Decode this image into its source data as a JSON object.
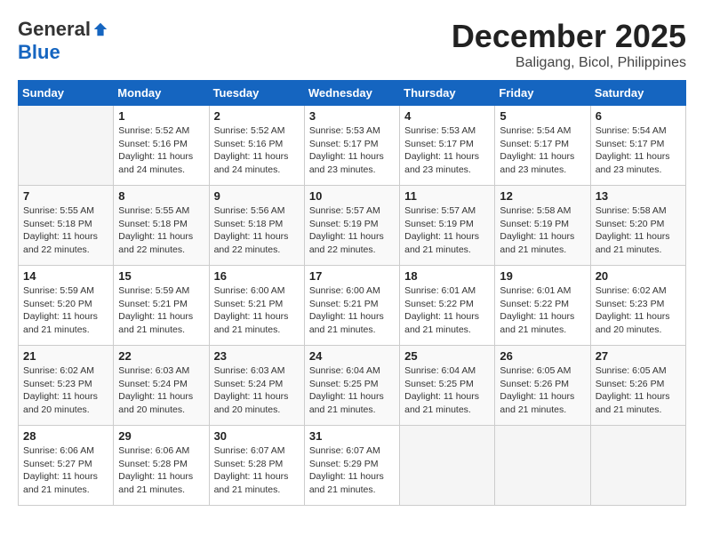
{
  "header": {
    "logo": {
      "general": "General",
      "blue": "Blue"
    },
    "month": "December 2025",
    "location": "Baligang, Bicol, Philippines"
  },
  "weekdays": [
    "Sunday",
    "Monday",
    "Tuesday",
    "Wednesday",
    "Thursday",
    "Friday",
    "Saturday"
  ],
  "weeks": [
    [
      {
        "day": "",
        "info": ""
      },
      {
        "day": "1",
        "info": "Sunrise: 5:52 AM\nSunset: 5:16 PM\nDaylight: 11 hours\nand 24 minutes."
      },
      {
        "day": "2",
        "info": "Sunrise: 5:52 AM\nSunset: 5:16 PM\nDaylight: 11 hours\nand 24 minutes."
      },
      {
        "day": "3",
        "info": "Sunrise: 5:53 AM\nSunset: 5:17 PM\nDaylight: 11 hours\nand 23 minutes."
      },
      {
        "day": "4",
        "info": "Sunrise: 5:53 AM\nSunset: 5:17 PM\nDaylight: 11 hours\nand 23 minutes."
      },
      {
        "day": "5",
        "info": "Sunrise: 5:54 AM\nSunset: 5:17 PM\nDaylight: 11 hours\nand 23 minutes."
      },
      {
        "day": "6",
        "info": "Sunrise: 5:54 AM\nSunset: 5:17 PM\nDaylight: 11 hours\nand 23 minutes."
      }
    ],
    [
      {
        "day": "7",
        "info": "Sunrise: 5:55 AM\nSunset: 5:18 PM\nDaylight: 11 hours\nand 22 minutes."
      },
      {
        "day": "8",
        "info": "Sunrise: 5:55 AM\nSunset: 5:18 PM\nDaylight: 11 hours\nand 22 minutes."
      },
      {
        "day": "9",
        "info": "Sunrise: 5:56 AM\nSunset: 5:18 PM\nDaylight: 11 hours\nand 22 minutes."
      },
      {
        "day": "10",
        "info": "Sunrise: 5:57 AM\nSunset: 5:19 PM\nDaylight: 11 hours\nand 22 minutes."
      },
      {
        "day": "11",
        "info": "Sunrise: 5:57 AM\nSunset: 5:19 PM\nDaylight: 11 hours\nand 21 minutes."
      },
      {
        "day": "12",
        "info": "Sunrise: 5:58 AM\nSunset: 5:19 PM\nDaylight: 11 hours\nand 21 minutes."
      },
      {
        "day": "13",
        "info": "Sunrise: 5:58 AM\nSunset: 5:20 PM\nDaylight: 11 hours\nand 21 minutes."
      }
    ],
    [
      {
        "day": "14",
        "info": "Sunrise: 5:59 AM\nSunset: 5:20 PM\nDaylight: 11 hours\nand 21 minutes."
      },
      {
        "day": "15",
        "info": "Sunrise: 5:59 AM\nSunset: 5:21 PM\nDaylight: 11 hours\nand 21 minutes."
      },
      {
        "day": "16",
        "info": "Sunrise: 6:00 AM\nSunset: 5:21 PM\nDaylight: 11 hours\nand 21 minutes."
      },
      {
        "day": "17",
        "info": "Sunrise: 6:00 AM\nSunset: 5:21 PM\nDaylight: 11 hours\nand 21 minutes."
      },
      {
        "day": "18",
        "info": "Sunrise: 6:01 AM\nSunset: 5:22 PM\nDaylight: 11 hours\nand 21 minutes."
      },
      {
        "day": "19",
        "info": "Sunrise: 6:01 AM\nSunset: 5:22 PM\nDaylight: 11 hours\nand 21 minutes."
      },
      {
        "day": "20",
        "info": "Sunrise: 6:02 AM\nSunset: 5:23 PM\nDaylight: 11 hours\nand 20 minutes."
      }
    ],
    [
      {
        "day": "21",
        "info": "Sunrise: 6:02 AM\nSunset: 5:23 PM\nDaylight: 11 hours\nand 20 minutes."
      },
      {
        "day": "22",
        "info": "Sunrise: 6:03 AM\nSunset: 5:24 PM\nDaylight: 11 hours\nand 20 minutes."
      },
      {
        "day": "23",
        "info": "Sunrise: 6:03 AM\nSunset: 5:24 PM\nDaylight: 11 hours\nand 20 minutes."
      },
      {
        "day": "24",
        "info": "Sunrise: 6:04 AM\nSunset: 5:25 PM\nDaylight: 11 hours\nand 21 minutes."
      },
      {
        "day": "25",
        "info": "Sunrise: 6:04 AM\nSunset: 5:25 PM\nDaylight: 11 hours\nand 21 minutes."
      },
      {
        "day": "26",
        "info": "Sunrise: 6:05 AM\nSunset: 5:26 PM\nDaylight: 11 hours\nand 21 minutes."
      },
      {
        "day": "27",
        "info": "Sunrise: 6:05 AM\nSunset: 5:26 PM\nDaylight: 11 hours\nand 21 minutes."
      }
    ],
    [
      {
        "day": "28",
        "info": "Sunrise: 6:06 AM\nSunset: 5:27 PM\nDaylight: 11 hours\nand 21 minutes."
      },
      {
        "day": "29",
        "info": "Sunrise: 6:06 AM\nSunset: 5:28 PM\nDaylight: 11 hours\nand 21 minutes."
      },
      {
        "day": "30",
        "info": "Sunrise: 6:07 AM\nSunset: 5:28 PM\nDaylight: 11 hours\nand 21 minutes."
      },
      {
        "day": "31",
        "info": "Sunrise: 6:07 AM\nSunset: 5:29 PM\nDaylight: 11 hours\nand 21 minutes."
      },
      {
        "day": "",
        "info": ""
      },
      {
        "day": "",
        "info": ""
      },
      {
        "day": "",
        "info": ""
      }
    ]
  ]
}
